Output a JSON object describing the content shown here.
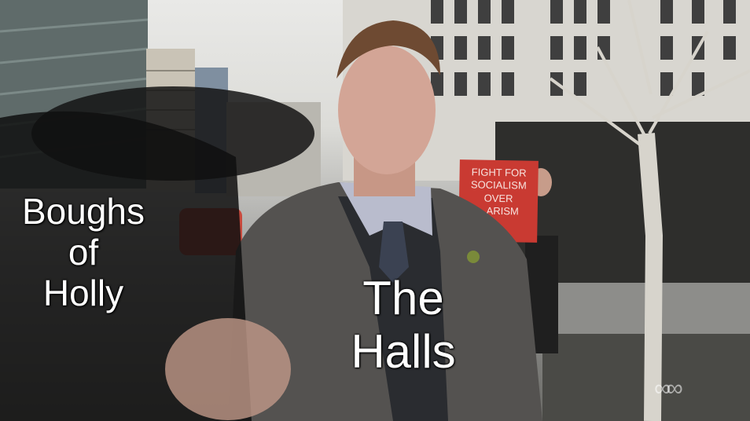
{
  "captions": {
    "left": "Boughs\nof\nHolly",
    "right": "The\nHalls"
  },
  "sign": {
    "lines": [
      "FIGHT FOR",
      "SOCIALISM",
      "OVER",
      "...ARISM"
    ]
  },
  "colors": {
    "caption_text": "#ffffff",
    "sign_red": "#c93a32",
    "sky": "#e9e9e7"
  },
  "icons": {
    "watermark": "abc-logo"
  }
}
